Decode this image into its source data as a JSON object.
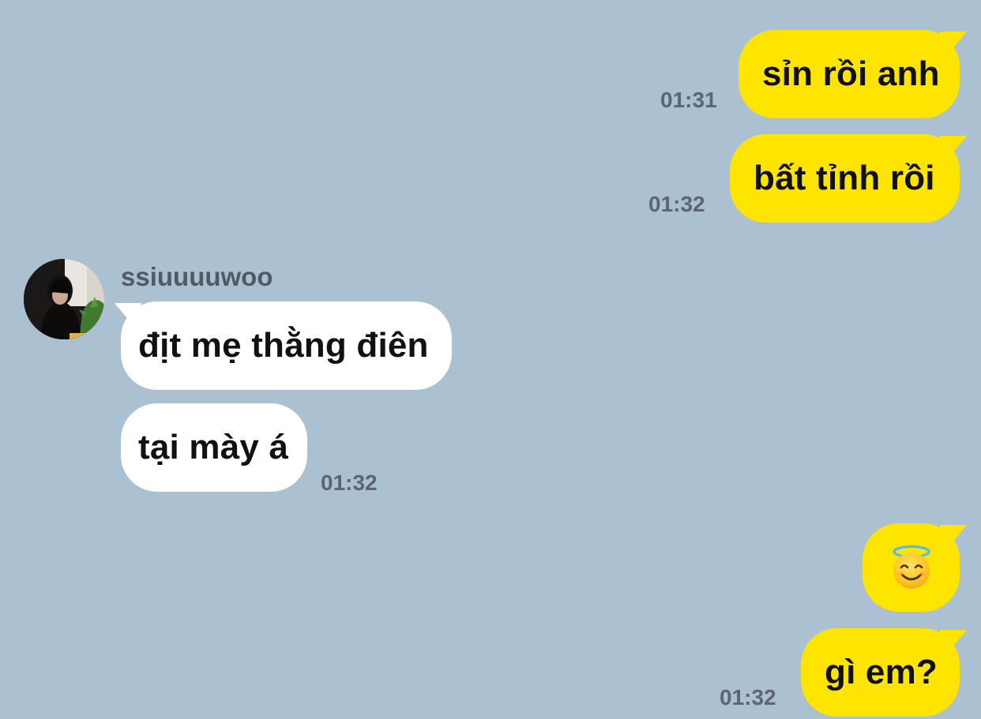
{
  "conversation": {
    "contact_name": "ssiuuuuwoo",
    "messages": [
      {
        "direction": "outgoing",
        "text": "sỉn rồi anh",
        "time": "01:31"
      },
      {
        "direction": "outgoing",
        "text": "bất tỉnh rồi",
        "time": "01:32"
      },
      {
        "direction": "incoming",
        "text": "địt mẹ thằng điên",
        "time": ""
      },
      {
        "direction": "incoming",
        "text": "tại mày á",
        "time": "01:32"
      },
      {
        "direction": "outgoing",
        "emoji": "smiling-face-with-halo",
        "time": ""
      },
      {
        "direction": "outgoing",
        "text": "gì em?",
        "time": "01:32"
      }
    ]
  },
  "theme": {
    "background": "#abc1d1",
    "outgoing_bubble": "#fee500",
    "incoming_bubble": "#ffffff",
    "timestamp_color": "#5b6670"
  }
}
